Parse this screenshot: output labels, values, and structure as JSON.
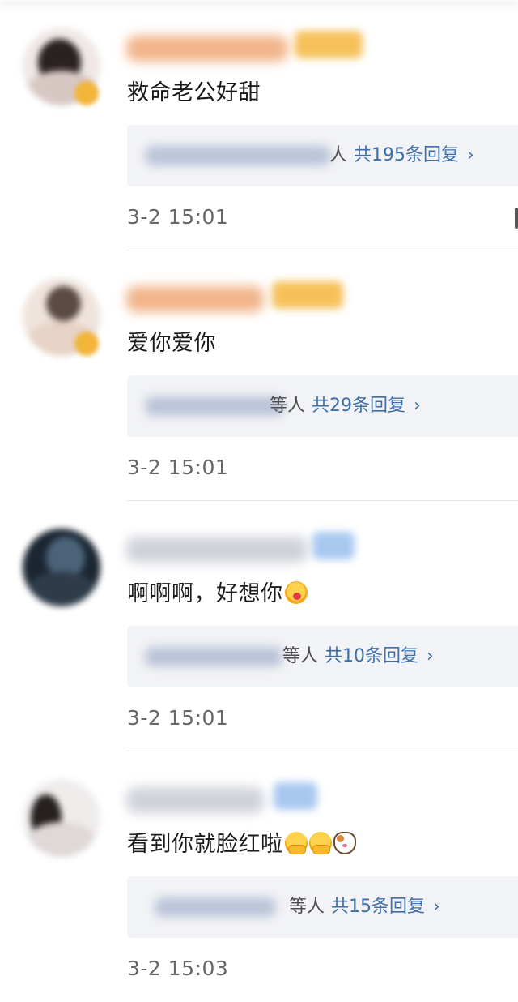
{
  "comments": [
    {
      "text": "救命老公好甜",
      "reply_suffix": "人",
      "reply_count_label": "共195条回复",
      "chevron": "›",
      "time": "3-2 15:01",
      "verified": true,
      "avatar_colors": [
        "#efe8e6",
        "#2a2222"
      ]
    },
    {
      "text": "爱你爱你",
      "reply_suffix": "等人",
      "reply_count_label": "共29条回复",
      "chevron": "›",
      "time": "3-2 15:01",
      "verified": true,
      "avatar_colors": [
        "#efe4dd",
        "#5b4a45"
      ]
    },
    {
      "text": "啊啊啊，好想你",
      "reply_suffix": "等人",
      "reply_count_label": "共10条回复",
      "chevron": "›",
      "time": "3-2 15:01",
      "verified": false,
      "avatar_colors": [
        "#1b2632",
        "#4b6378"
      ]
    },
    {
      "text": "看到你就脸红啦",
      "reply_suffix": "等人",
      "reply_count_label": "共15条回复",
      "chevron": "›",
      "time": "3-2 15:03",
      "verified": false,
      "avatar_colors": [
        "#efecec",
        "#262020"
      ]
    }
  ],
  "icons": {
    "comment_1_emoji": [
      "blush-face-icon"
    ],
    "comment_4_emoji": [
      "hugging-face-icon",
      "hugging-face-icon",
      "cat-face-icon"
    ],
    "chevron": "chevron-right-icon"
  },
  "colors": {
    "reply_count": "#3e6ea8",
    "reply_box_bg": "#f2f3f6",
    "vip_name": "#f2a463",
    "normal_name": "#c9ccd4",
    "vip_badge": "#f5b13a",
    "normal_badge": "#9fc2ee"
  }
}
